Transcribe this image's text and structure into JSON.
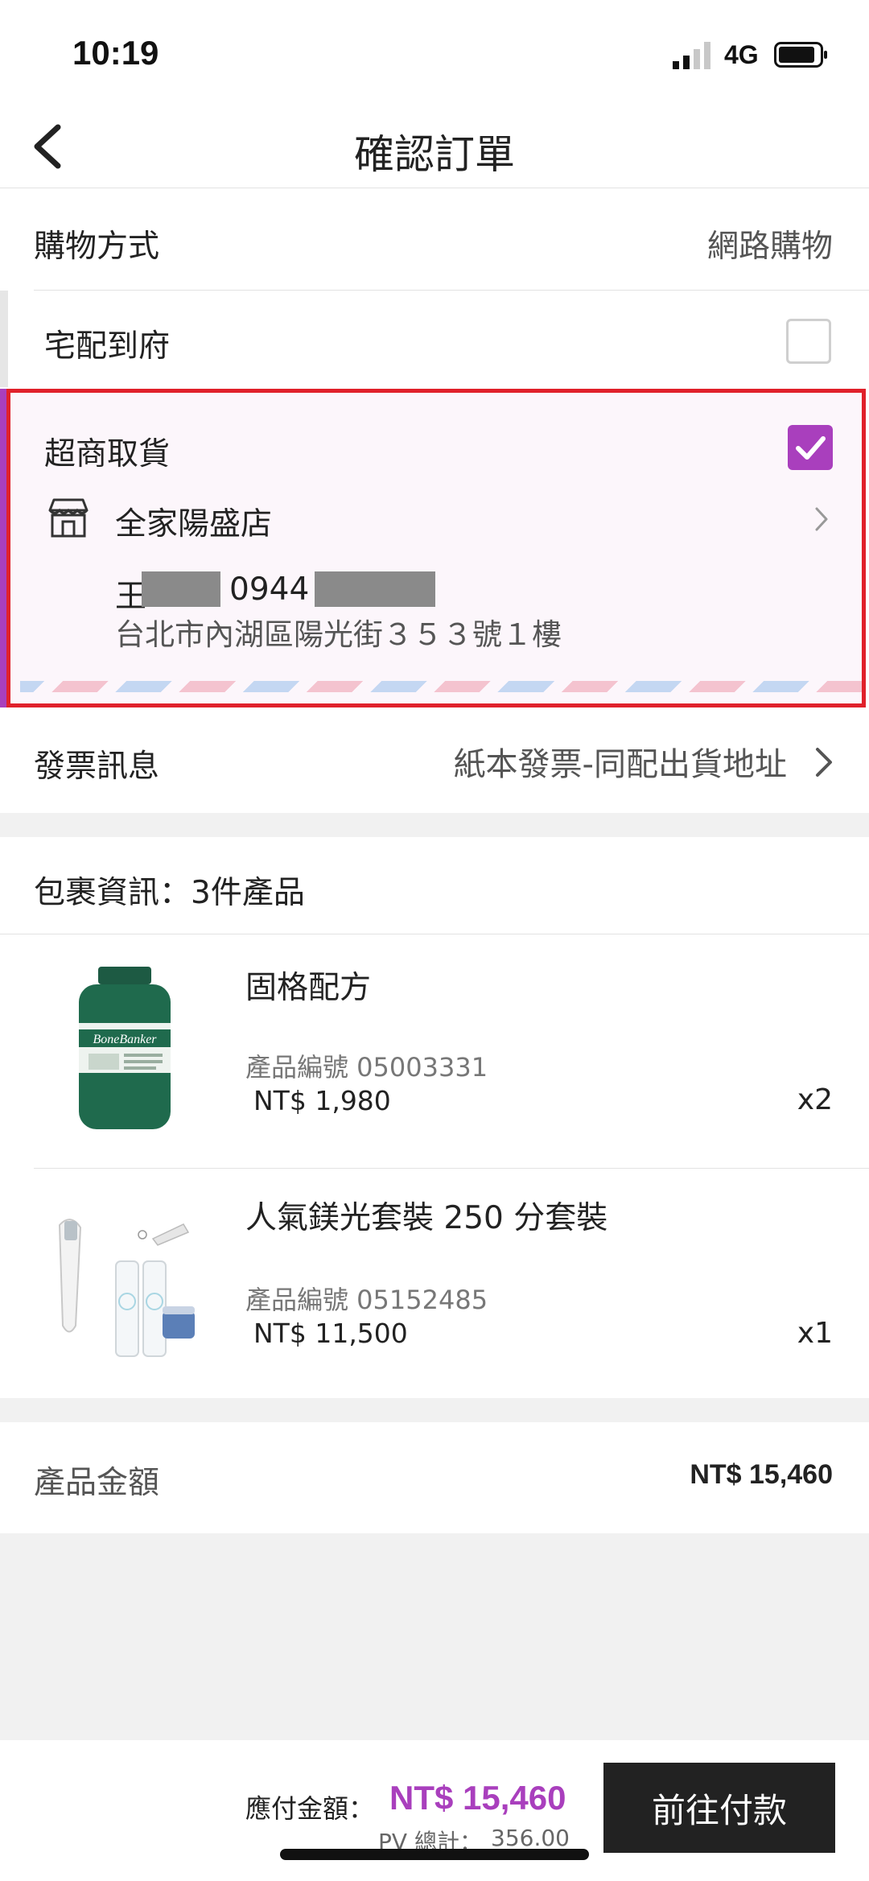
{
  "status_bar": {
    "time": "10:19",
    "network": "4G"
  },
  "nav": {
    "title": "確認訂單"
  },
  "shopping_method": {
    "label": "購物方式",
    "value": "網路購物"
  },
  "home_delivery": {
    "label": "宅配到府",
    "checked": false
  },
  "store_pickup": {
    "label": "超商取貨",
    "checked": true,
    "store_name": "全家陽盛店",
    "recipient_surname": "王",
    "phone_partial": "0944",
    "address": "台北市內湖區陽光街３５３號１樓"
  },
  "invoice": {
    "label": "發票訊息",
    "value": "紙本發票-同配出貨地址"
  },
  "package": {
    "title": "包裹資訊：3件產品"
  },
  "products": [
    {
      "name": "固格配方",
      "code": "產品編號 05003331",
      "price": "NT$ 1,980",
      "qty": "x2"
    },
    {
      "name": "人氣鎂光套裝 250 分套裝",
      "code": "產品編號 05152485",
      "price": "NT$ 11,500",
      "qty": "x1"
    }
  ],
  "product_total": {
    "label": "產品金額",
    "value": "NT$ 15,460"
  },
  "payment": {
    "label": "應付金額：",
    "amount": "NT$ 15,460",
    "pv_label": "PV 總計：",
    "pv_value": "356.00",
    "button_label": "前往付款"
  },
  "colors": {
    "accent": "#a93fbd",
    "highlight_border": "#e0212b",
    "button_bg": "#222222"
  },
  "icons": [
    "back-chevron-icon",
    "signal-icon",
    "battery-icon",
    "store-icon",
    "chevron-right-icon",
    "checkmark-icon"
  ]
}
